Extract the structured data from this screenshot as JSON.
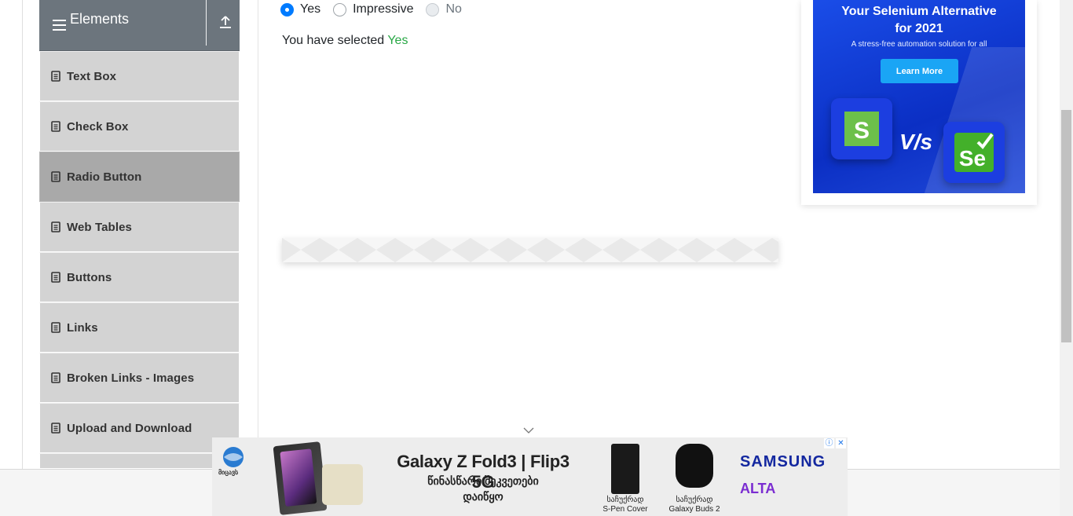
{
  "sidebar": {
    "group_title": "Elements",
    "items": [
      {
        "label": "Text Box"
      },
      {
        "label": "Check Box"
      },
      {
        "label": "Radio Button"
      },
      {
        "label": "Web Tables"
      },
      {
        "label": "Buttons"
      },
      {
        "label": "Links"
      },
      {
        "label": "Broken Links - Images"
      },
      {
        "label": "Upload and Download"
      }
    ],
    "active_index": 2
  },
  "radio": {
    "options": [
      {
        "label": "Yes",
        "checked": true,
        "disabled": false
      },
      {
        "label": "Impressive",
        "checked": false,
        "disabled": false
      },
      {
        "label": "No",
        "checked": false,
        "disabled": true
      }
    ],
    "result_prefix": "You have selected",
    "result_value": "Yes"
  },
  "right_ad": {
    "title_line1": "Your Selenium Alternative",
    "title_line2": "for 2021",
    "subtitle": "A stress-free automation solution for all",
    "button": "Learn More",
    "vs": "V/s",
    "logo_left": "S",
    "logo_right": "Se"
  },
  "bottom_ad": {
    "logo_text": "მიცავს",
    "headline": "Galaxy Z Fold3 | Flip3 5G",
    "line2": "წინასწარი შეკვეთები",
    "line3": "დაიწყო",
    "product1_top": "საჩუქრად",
    "product1": "S-Pen Cover",
    "product2_top": "საჩუქრად",
    "product2": "Galaxy Buds 2",
    "brand1": "SAMSUNG",
    "brand2": "ALTA",
    "info_icon": "ⓘ",
    "close_icon": "✕"
  },
  "colors": {
    "sidebar_header": "#6c757d",
    "menu_item": "#d3d3d3",
    "menu_active": "#a9a9a9",
    "radio_accent": "#007bff",
    "result_value": "#28a745"
  }
}
